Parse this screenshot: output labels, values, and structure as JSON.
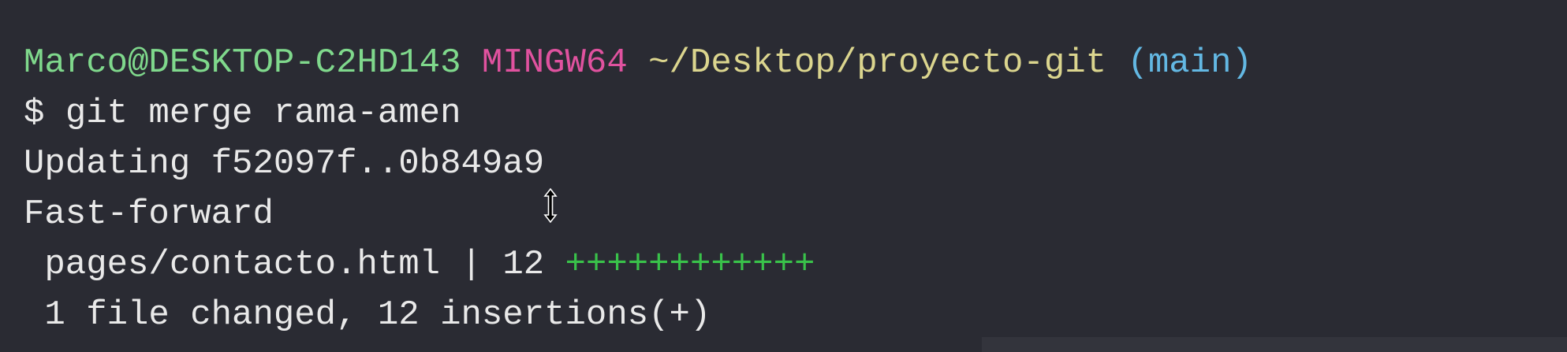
{
  "prompt": {
    "user_host": "Marco@DESKTOP-C2HD143",
    "system": "MINGW64",
    "path": "~/Desktop/proyecto-git",
    "branch": "(main)"
  },
  "command": {
    "symbol": "$",
    "text": "git merge rama-amen"
  },
  "output": {
    "updating": "Updating f52097f..0b849a9",
    "mode": "Fast-forward",
    "file_path": "pages/contacto.html",
    "separator": "|",
    "changes_count": "12",
    "plus_bar": "++++++++++++",
    "summary": "1 file changed, 12 insertions(+)"
  },
  "colors": {
    "background": "#2a2b33",
    "user_host": "#7fd88c",
    "system": "#e0529f",
    "path": "#dbd58e",
    "branch": "#63b8e3",
    "insertions": "#39c24a",
    "text": "#e9e9e9"
  },
  "cursor_icon": "resize-vertical-cursor-icon"
}
